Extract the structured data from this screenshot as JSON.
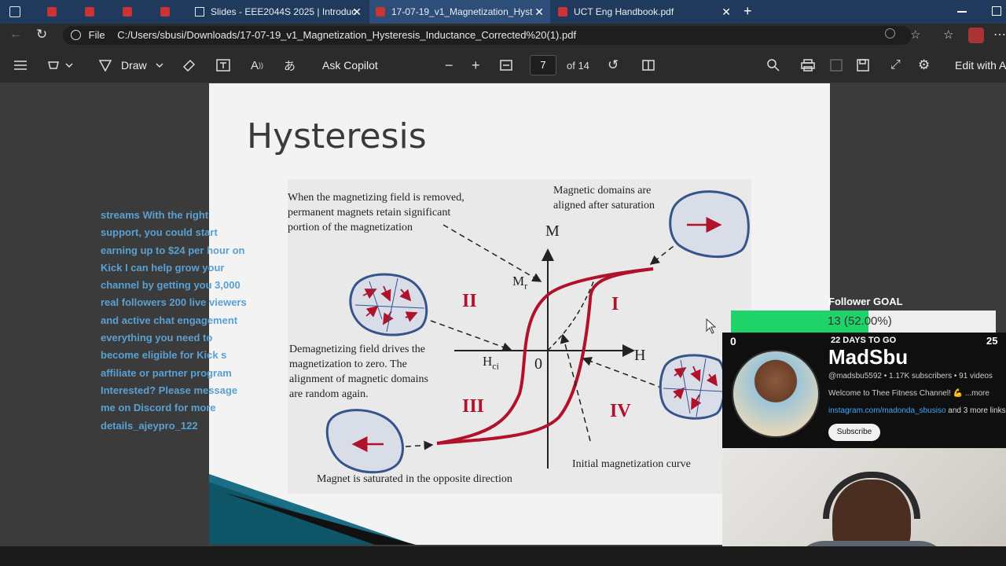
{
  "tabs": [
    {
      "label": "Slides - EEE2044S 2025 | Introduc"
    },
    {
      "label": "17-07-19_v1_Magnetization_Hyst"
    },
    {
      "label": "UCT Eng Handbook.pdf"
    }
  ],
  "address": {
    "scheme": "File",
    "path": "C:/Users/sbusi/Downloads/17-07-19_v1_Magnetization_Hysteresis_Inductance_Corrected%20(1).pdf"
  },
  "toolbar": {
    "draw": "Draw",
    "copilot": "Ask Copilot",
    "page": "7",
    "page_total": "of 14",
    "edit": "Edit with A"
  },
  "slide": {
    "title": "Hysteresis",
    "notes": {
      "removed": [
        "When the magnetizing field is removed,",
        "permanent magnets retain significant",
        "portion of the magnetization"
      ],
      "aligned": [
        "Magnetic domains are",
        "aligned after saturation"
      ],
      "demag": [
        "Demagnetizing field drives the",
        "magnetization to zero. The",
        "alignment of magnetic domains",
        "are random again."
      ],
      "opposite": "Magnet is saturated in the opposite direction",
      "initial": "Initial magnetization curve"
    },
    "labels": {
      "m": "M",
      "h": "H",
      "mr": "M",
      "mr_sub": "r",
      "hci": "H",
      "hci_sub": "ci",
      "zero": "0",
      "q1": "I",
      "q2": "II",
      "q3": "III",
      "q4": "IV"
    }
  },
  "chat": "streams With the right support, you could start earning up to $24 per hour on Kick I can help grow your channel by getting you 3,000 real followers 200 live viewers and active chat engagement everything you need to become eligible for Kick s affiliate or partner program Interested? Please message me on Discord for more details_ajeypro_122",
  "goal": {
    "title": "Follower GOAL",
    "text": "13 (52.00%)",
    "fraction": 0.52,
    "min": "0",
    "max": "25",
    "days": "22 DAYS TO GO"
  },
  "channel": {
    "name": "MadSbu",
    "meta": "@madsbu5592 • 1.17K subscribers • 91 videos",
    "desc": "Welcome to Thee Fitness Channel! 💪 ...more",
    "link": "instagram.com/madonda_sbusiso",
    "link_more": " and 3 more links",
    "subscribe": "Subscribe"
  },
  "colors": {
    "tabbar": "#1f3a5c",
    "goal_fill": "#1fd36a",
    "curve": "#b0122c",
    "domain": "#36548c",
    "chat": "#5aa0d2"
  }
}
